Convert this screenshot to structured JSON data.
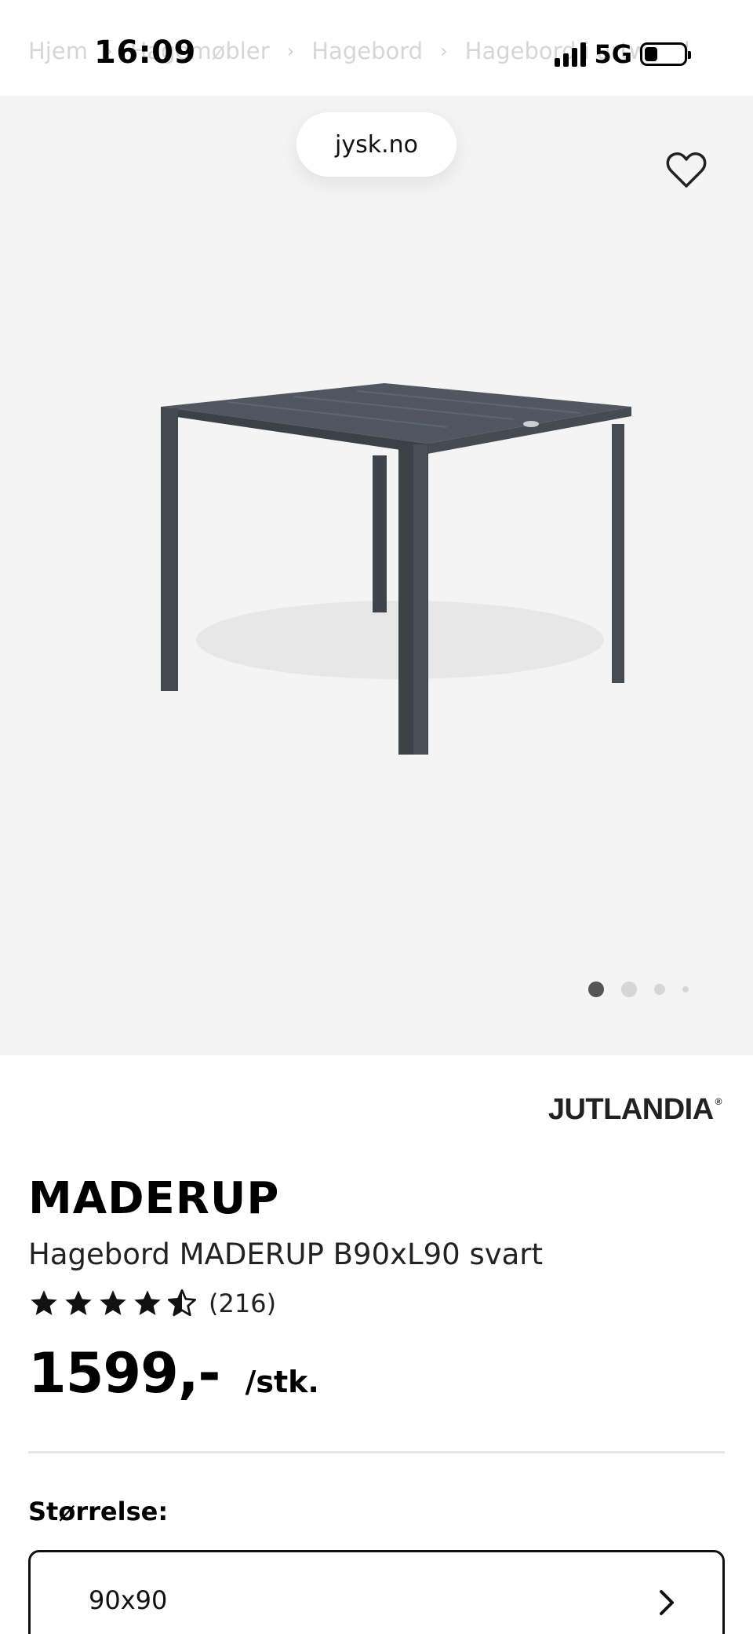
{
  "status_bar": {
    "time": "16:09",
    "network": "5G"
  },
  "breadcrumb": {
    "items": [
      "Hjem",
      "Hagemøbler",
      "Hagebord",
      "Hagebord i artwood"
    ]
  },
  "browser": {
    "url": "jysk.no"
  },
  "gallery": {
    "total_images": 4,
    "active_index": 0
  },
  "product": {
    "brand": "JUTLANDIA",
    "brand_mark": "®",
    "name": "MADERUP",
    "description": "Hagebord MADERUP B90xL90 svart",
    "rating_value": 4.5,
    "rating_max": 5,
    "review_count": "(216)",
    "price": "1599,-",
    "price_unit": "/stk."
  },
  "size_selector": {
    "label": "Størrelse:",
    "value": "90x90"
  },
  "icons": {
    "favorite": "heart-outline-icon",
    "size_open": "chevron-right-icon",
    "star_full": "star-filled-icon",
    "star_half": "star-half-icon"
  },
  "colors": {
    "hero_background": "#f4f4f4",
    "text": "#111111",
    "divider": "#e6e6e6",
    "dot_active": "#555555",
    "dot_inactive": "#d6d6d6",
    "table": "#4a5058"
  }
}
